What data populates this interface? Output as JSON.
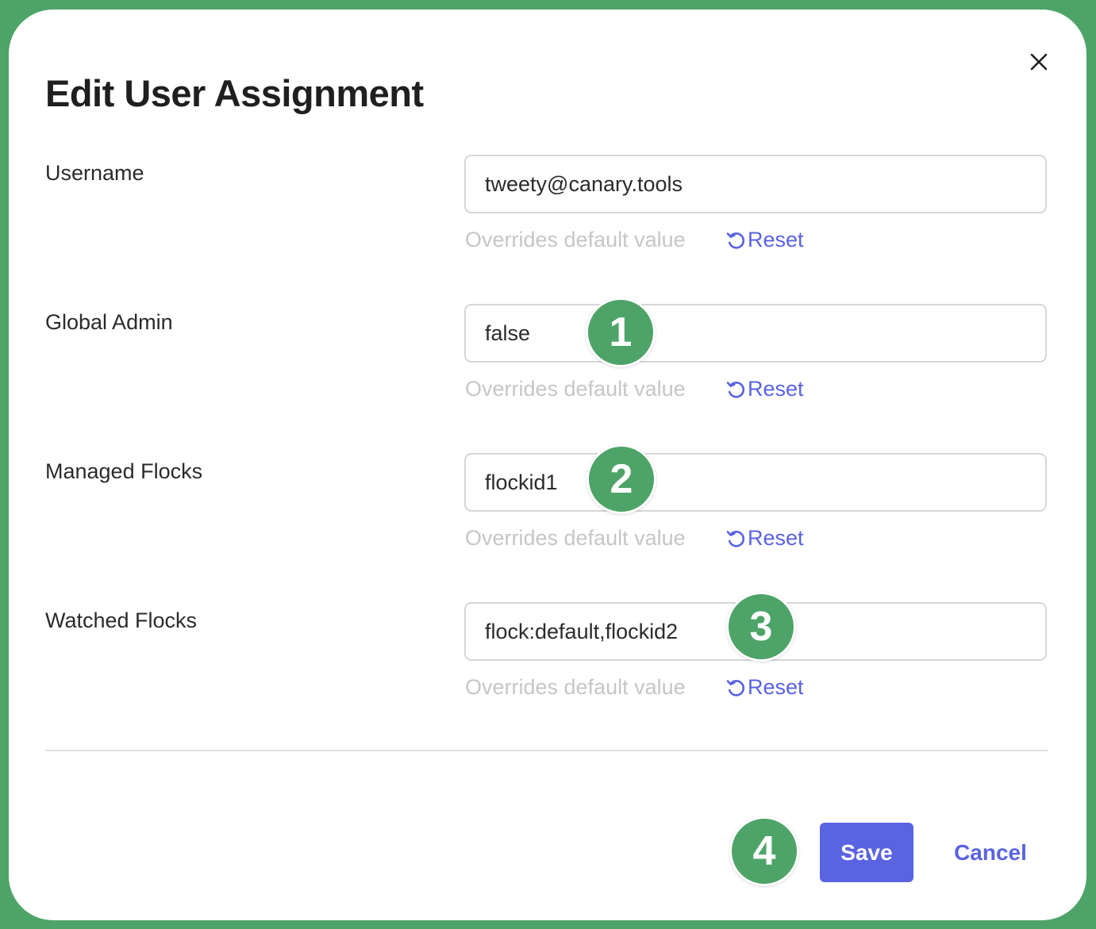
{
  "dialog": {
    "title": "Edit User Assignment"
  },
  "fields": [
    {
      "label": "Username",
      "value": "tweety@canary.tools",
      "hint": "Overrides default value",
      "reset_label": "Reset"
    },
    {
      "label": "Global Admin",
      "value": "false",
      "hint": "Overrides default value",
      "reset_label": "Reset"
    },
    {
      "label": "Managed Flocks",
      "value": "flockid1",
      "hint": "Overrides default value",
      "reset_label": "Reset"
    },
    {
      "label": "Watched Flocks",
      "value": "flock:default,flockid2",
      "hint": "Overrides default value",
      "reset_label": "Reset"
    }
  ],
  "badges": [
    "1",
    "2",
    "3",
    "4"
  ],
  "actions": {
    "save_label": "Save",
    "cancel_label": "Cancel"
  },
  "icons": {
    "close": "close-icon",
    "reset": "reset-icon"
  },
  "colors": {
    "accent": "#5a63e0",
    "badge": "#4ea468",
    "background": "#4ea468",
    "hint": "#c6c6c6"
  }
}
